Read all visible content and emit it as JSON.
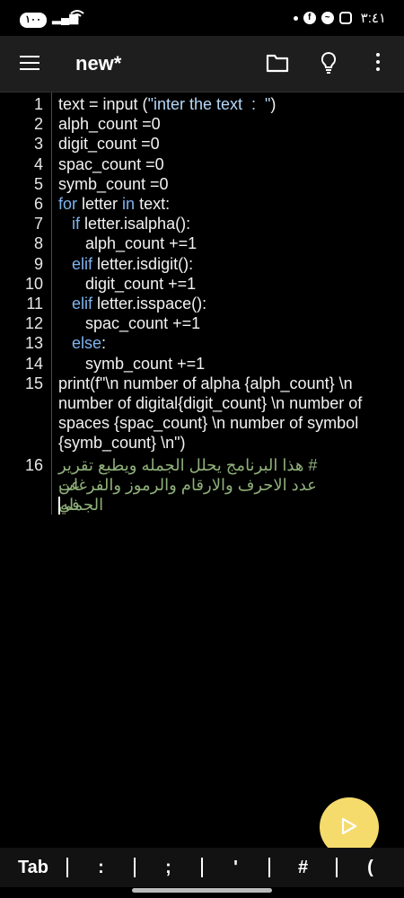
{
  "status_bar": {
    "battery": "١٠٠",
    "time": "٣:٤١",
    "notification_icons": [
      "facebook-icon",
      "messenger-icon",
      "instagram-icon"
    ]
  },
  "app_bar": {
    "title": "new*"
  },
  "editor": {
    "lines": [
      {
        "number": "1",
        "indent": "",
        "parts": [
          {
            "t": "text = input ("
          },
          {
            "t": "\"inter the text  :  \"",
            "c": "str"
          },
          {
            "t": ")"
          }
        ]
      },
      {
        "number": "2",
        "indent": "",
        "parts": [
          {
            "t": "alph_count =0"
          }
        ]
      },
      {
        "number": "3",
        "indent": "",
        "parts": [
          {
            "t": "digit_count =0"
          }
        ]
      },
      {
        "number": "4",
        "indent": "",
        "parts": [
          {
            "t": "spac_count =0"
          }
        ]
      },
      {
        "number": "5",
        "indent": "",
        "parts": [
          {
            "t": "symb_count =0"
          }
        ]
      },
      {
        "number": "6",
        "indent": "",
        "parts": [
          {
            "t": "for",
            "c": "kw"
          },
          {
            "t": " letter "
          },
          {
            "t": "in",
            "c": "kw"
          },
          {
            "t": " text:"
          }
        ]
      },
      {
        "number": "7",
        "indent": "   ",
        "parts": [
          {
            "t": "if",
            "c": "kw"
          },
          {
            "t": " letter.isalpha():"
          }
        ]
      },
      {
        "number": "8",
        "indent": "      ",
        "parts": [
          {
            "t": "alph_count +=1"
          }
        ]
      },
      {
        "number": "9",
        "indent": "   ",
        "parts": [
          {
            "t": "elif",
            "c": "kw"
          },
          {
            "t": " letter.isdigit():"
          }
        ]
      },
      {
        "number": "10",
        "indent": "      ",
        "parts": [
          {
            "t": "digit_count +=1"
          }
        ]
      },
      {
        "number": "11",
        "indent": "   ",
        "parts": [
          {
            "t": "elif",
            "c": "kw"
          },
          {
            "t": " letter.isspace():"
          }
        ]
      },
      {
        "number": "12",
        "indent": "      ",
        "parts": [
          {
            "t": "spac_count +=1"
          }
        ]
      },
      {
        "number": "13",
        "indent": "   ",
        "parts": [
          {
            "t": "else",
            "c": "kw"
          },
          {
            "t": ":"
          }
        ]
      },
      {
        "number": "14",
        "indent": "      ",
        "parts": [
          {
            "t": "symb_count +=1"
          }
        ]
      },
      {
        "number": "15",
        "indent": "",
        "parts": [
          {
            "t": "print(f\"\\n number of alpha {alph_count} \\n"
          }
        ]
      },
      {
        "number": "",
        "indent": "",
        "parts": [
          {
            "t": "number of digital{digit_count} \\n number of"
          }
        ]
      },
      {
        "number": "",
        "indent": "",
        "parts": [
          {
            "t": "spaces {spac_count} \\n number of symbol"
          }
        ]
      },
      {
        "number": "",
        "indent": "",
        "parts": [
          {
            "t": "{symb_count} \\n\")"
          }
        ]
      }
    ],
    "comment_line_number": "16",
    "comment_lines": [
      "# هذا البرنامج يحلل الجمله ويطبع تقرير عن",
      "عدد الاحرف والارقام والرموز والفرغات في",
      "الجمله"
    ]
  },
  "keybar": {
    "keys": [
      "Tab",
      ":",
      ";",
      "'",
      "#",
      "("
    ]
  },
  "colors": {
    "background": "#000000",
    "toolbar": "#1e1e1e",
    "keyword": "#7fb4f0",
    "comment": "#8fb07a",
    "fab": "#f5db6c"
  },
  "icons": {
    "menu": "menu-icon",
    "folder": "folder-icon",
    "hint": "lightbulb-icon",
    "more": "more-vert-icon",
    "run": "play-icon"
  }
}
